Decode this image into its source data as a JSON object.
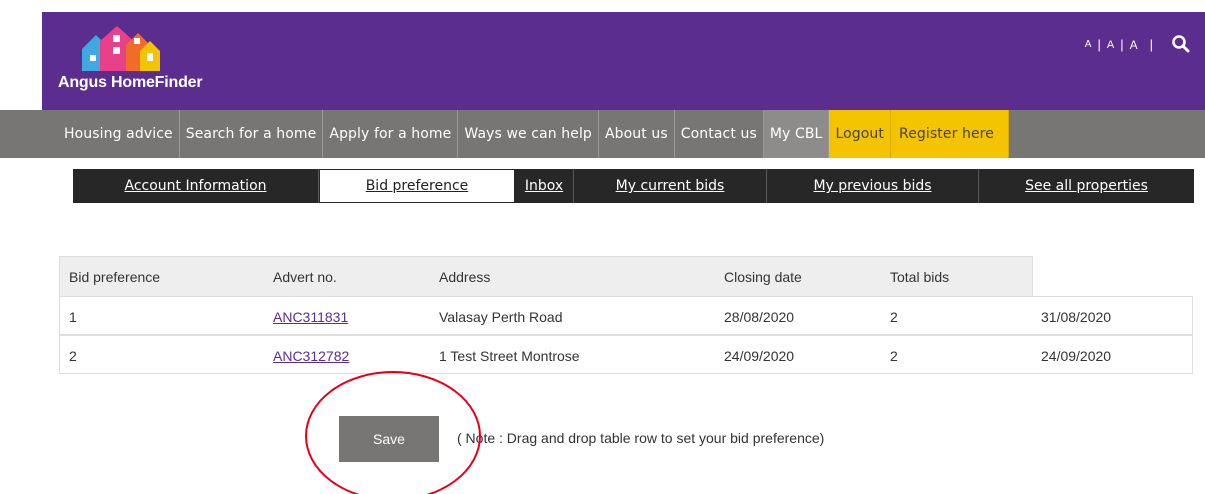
{
  "header": {
    "brand_name": "Angus HomeFinder",
    "text_size_options": [
      "A",
      "A",
      "A"
    ],
    "colors": {
      "header_bg": "#5b2d8e",
      "nav_bg": "#777674",
      "highlight": "#f5c400"
    }
  },
  "main_nav": {
    "items": [
      {
        "label": "Housing advice"
      },
      {
        "label": "Search for a home"
      },
      {
        "label": "Apply for a home"
      },
      {
        "label": "Ways we can help"
      },
      {
        "label": "About us"
      },
      {
        "label": "Contact us"
      },
      {
        "label": "My CBL"
      },
      {
        "label": "Logout"
      },
      {
        "label": "Register here"
      }
    ]
  },
  "sub_nav": {
    "items": [
      {
        "label": "Account Information"
      },
      {
        "label": "Bid preference"
      },
      {
        "label": "Inbox"
      },
      {
        "label": "My current bids"
      },
      {
        "label": "My previous bids"
      },
      {
        "label": "See all properties"
      }
    ]
  },
  "bids_table": {
    "columns": [
      "Bid preference",
      "Advert no.",
      "Address",
      "Closing date",
      "Total bids"
    ],
    "rows": [
      {
        "preference": "1",
        "advert_no": "ANC311831",
        "address": "Valasay Perth Road",
        "closing_date": "28/08/2020",
        "total_bids": "2",
        "extra_date": "31/08/2020"
      },
      {
        "preference": "2",
        "advert_no": "ANC312782",
        "address": "1 Test Street Montrose",
        "closing_date": "24/09/2020",
        "total_bids": "2",
        "extra_date": "24/09/2020"
      }
    ]
  },
  "actions": {
    "save_label": "Save",
    "note": "( Note : Drag and drop table row to set your bid preference)"
  }
}
